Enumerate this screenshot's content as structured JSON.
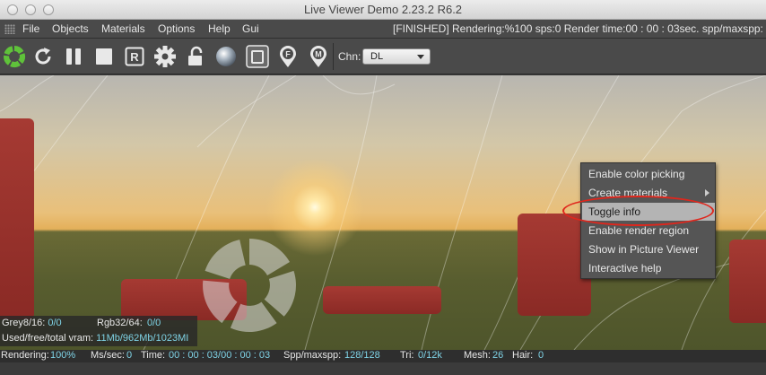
{
  "window": {
    "title": "Live Viewer Demo 2.23.2 R6.2"
  },
  "menu": {
    "items": [
      "File",
      "Objects",
      "Materials",
      "Options",
      "Help",
      "Gui"
    ],
    "status_text": "[FINISHED]  Rendering:%100 sps:0 Render time:00 : 00 : 03sec. spp/maxspp:"
  },
  "toolbar": {
    "icons": [
      "octane-logo-icon",
      "refresh-icon",
      "pause-icon",
      "stop-icon",
      "r-icon",
      "gear-icon",
      "lock-icon",
      "sphere-icon",
      "region-icon",
      "focus-pin-icon",
      "material-pin-icon"
    ],
    "channel_label": "Chn:",
    "channel_value": "DL",
    "accent_green": "#5fc23a"
  },
  "info": {
    "grey_label": "Grey8/16:",
    "grey_value": "0/0",
    "rgb_label": "Rgb32/64:",
    "rgb_value": "0/0",
    "vram_label": "Used/free/total vram:",
    "vram_value": "11Mb/962Mb/1023MI"
  },
  "context_menu": {
    "items": [
      {
        "label": "Enable color picking",
        "active": false,
        "submenu": false
      },
      {
        "label": "Create materials",
        "active": false,
        "submenu": true
      },
      {
        "label": "Toggle info",
        "active": true,
        "submenu": false
      },
      {
        "label": "Enable render region",
        "active": false,
        "submenu": false
      },
      {
        "label": "Show in Picture Viewer",
        "active": false,
        "submenu": false
      },
      {
        "label": "Interactive help",
        "active": false,
        "submenu": false
      }
    ],
    "highlight_color": "#e0261c"
  },
  "statusbar": {
    "rendering_label": "Rendering:",
    "rendering_value": "100%",
    "ms_label": "Ms/sec:",
    "ms_value": "0",
    "time_label": "Time:",
    "time_value": "00 : 00 : 03/00 : 00 : 03",
    "spp_label": "Spp/maxspp:",
    "spp_value": "128/128",
    "tri_label": "Tri:",
    "tri_value": "0/12k",
    "mesh_label": "Mesh:",
    "mesh_value": "26",
    "hair_label": "Hair:",
    "hair_value": "0"
  }
}
